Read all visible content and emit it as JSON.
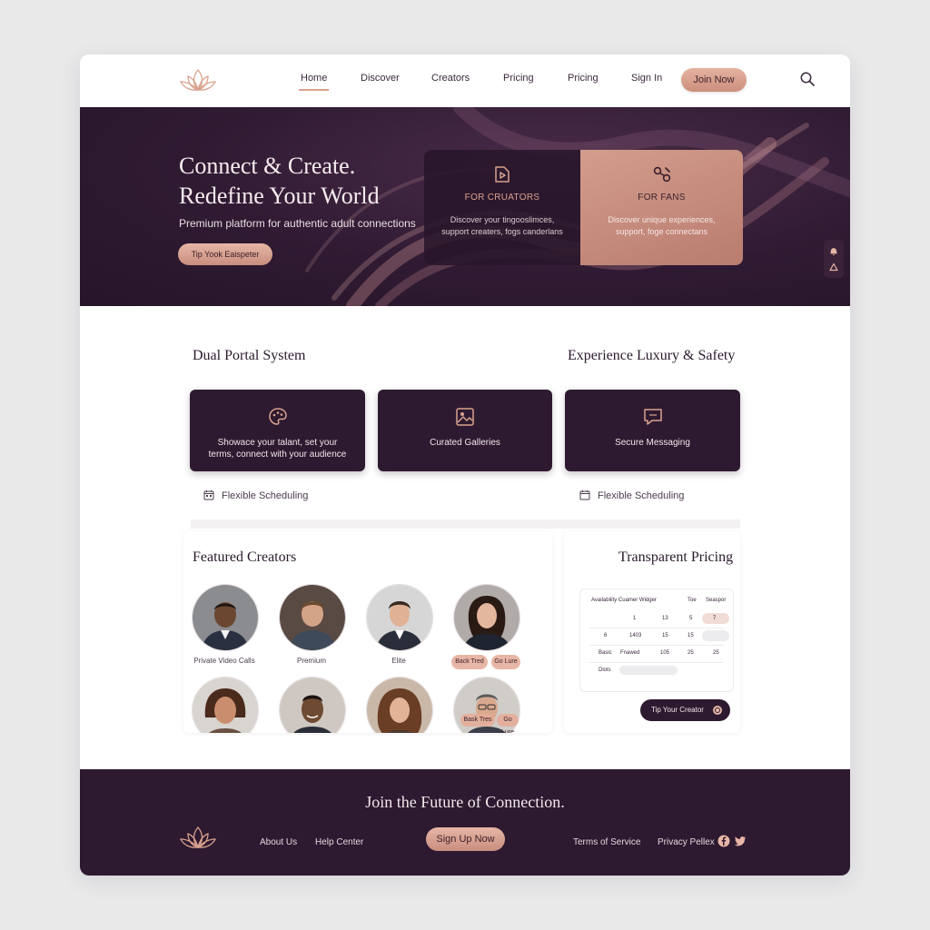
{
  "nav": {
    "links": [
      "Home",
      "Discover",
      "Creators",
      "Pricing",
      "Pricing",
      "Sign In"
    ],
    "join_label": "Join Now"
  },
  "hero": {
    "title": "Connect & Create.\nRedefine Your World",
    "subtitle": "Premium platform for authentic adult connections",
    "cta_label": "Tip Yook Eaispeter",
    "portals": [
      {
        "title": "FOR CRUATORS",
        "desc": "Discover your tingooslimces, support creaters, fogs canderlans",
        "icon": "play-icon"
      },
      {
        "title": "FOR FANS",
        "desc": "Discover unique experiences, support, foge connectans",
        "icon": "link-icon"
      }
    ]
  },
  "features": {
    "left_title": "Dual Portal System",
    "right_title": "Experience Luxury & Safety",
    "cards": [
      {
        "text": "Showace your talant, set your terms, connect with your audience",
        "icon": "palette-icon"
      },
      {
        "text": "Curated Galleries",
        "icon": "gallery-icon"
      },
      {
        "text": "Secure Messaging",
        "icon": "message-icon"
      }
    ],
    "scheduling": [
      "Flexible Scheduling",
      "Flexible Scheduling"
    ]
  },
  "featured": {
    "title": "Featured Creators",
    "captions": [
      "Private Video Calls",
      "Premium",
      "Elite"
    ],
    "chips": [
      "Back Tred",
      "Go Lure"
    ],
    "bottom_chips": [
      "Bask Tres",
      "Go Lure"
    ]
  },
  "pricing": {
    "title": "Transparent Pricing",
    "headers": [
      "Availability Cuamer Widger",
      "Toe",
      "Seaspor"
    ],
    "rows": [
      [
        "1",
        "13",
        "5",
        "7"
      ],
      [
        "6",
        "1403",
        "15",
        "15",
        ""
      ],
      [
        "Basic",
        "Fnawed",
        "105",
        "25",
        "25"
      ],
      [
        "Dlots"
      ]
    ],
    "tip_label": "Tip Your Creator"
  },
  "footer": {
    "title": "Join the Future of Connection.",
    "links": [
      "About Us",
      "Help Center",
      "Terms of Service",
      "Privacy Pellex"
    ],
    "signup_label": "Sign Up Now"
  },
  "colors": {
    "plum": "#2e1a30",
    "rose": "#d39d8c",
    "accent": "#d9a28e"
  }
}
